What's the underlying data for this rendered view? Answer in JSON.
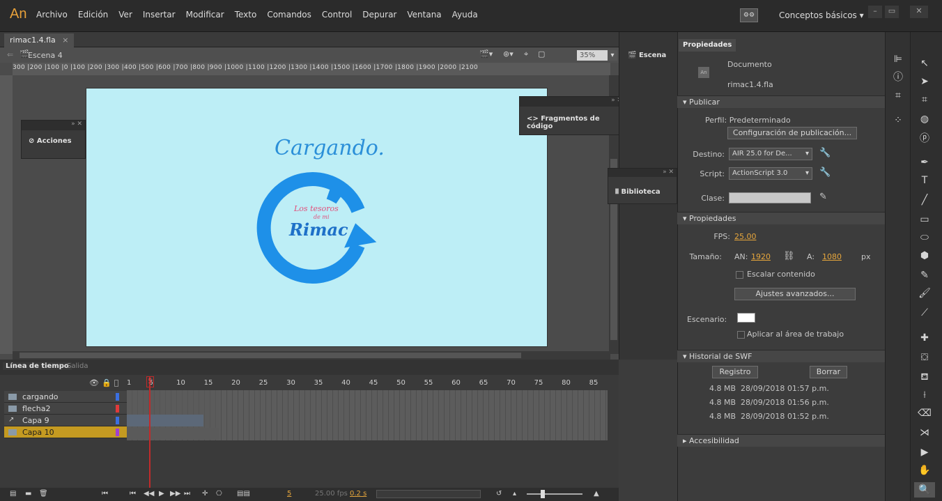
{
  "app": {
    "logo": "An",
    "menu": [
      "Archivo",
      "Edición",
      "Ver",
      "Insertar",
      "Modificar",
      "Texto",
      "Comandos",
      "Control",
      "Depurar",
      "Ventana",
      "Ayuda"
    ],
    "workspace": "Conceptos básicos",
    "win_min": "–",
    "win_max": "▭",
    "win_close": "✕"
  },
  "document": {
    "tab_label": "rimac1.4.fla",
    "tab_close": "×",
    "scene_label": "Escena 4",
    "zoom": "35%",
    "ruler_ticks": "300 |200 |100 |0 |100 |200 |300 |400 |500 |600 |700 |800 |900 |1000 |1100 |1200 |1300 |1400 |1500 |1600 |1700 |1800 |1900 |2000 |2100"
  },
  "stage": {
    "background": "#bdeef6",
    "title_text": "Cargando.",
    "logo_line1": "Los tesoros",
    "logo_line2": "de mi",
    "logo_line3": "Rimac",
    "accent": "#1e90e8"
  },
  "panels": {
    "acciones": "Acciones",
    "fragmentos": "Fragmentos de código",
    "escena": "Escena",
    "biblioteca": "Biblioteca"
  },
  "properties": {
    "tab": "Propiedades",
    "doc_type": "Documento",
    "doc_name": "rimac1.4.fla",
    "publicar": {
      "header": "Publicar",
      "perfil": "Perfil: Predeterminado",
      "config_button": "Configuración de publicación...",
      "destino_label": "Destino:",
      "destino_value": "AIR 25.0 for De...",
      "script_label": "Script:",
      "script_value": "ActionScript 3.0",
      "clase_label": "Clase:"
    },
    "propiedades": {
      "header": "Propiedades",
      "fps_label": "FPS:",
      "fps_value": "25.00",
      "tamano_label": "Tamaño:",
      "an_label": "AN:",
      "an_value": "1920",
      "a_label": "A:",
      "a_value": "1080",
      "unit": "px",
      "escalar": "Escalar contenido",
      "ajustes_button": "Ajustes avanzados...",
      "escenario_label": "Escenario:",
      "aplicar": "Aplicar al área de trabajo"
    },
    "historial": {
      "header": "Historial de SWF",
      "registro_button": "Registro",
      "borrar_button": "Borrar",
      "entries": [
        {
          "size": "4.8 MB",
          "date": "28/09/2018",
          "time": "01:57 p.m."
        },
        {
          "size": "4.8 MB",
          "date": "28/09/2018",
          "time": "01:56 p.m."
        },
        {
          "size": "4.8 MB",
          "date": "28/09/2018",
          "time": "01:52 p.m."
        }
      ]
    },
    "accesibilidad": "Accesibilidad"
  },
  "timeline": {
    "tab_active": "Línea de tiempo",
    "tab_other": "Salida",
    "frame_numbers": [
      "1",
      "5",
      "10",
      "15",
      "20",
      "25",
      "30",
      "35",
      "40",
      "45",
      "50",
      "55",
      "60",
      "65",
      "70",
      "75",
      "80",
      "85"
    ],
    "current_frame": "5",
    "layers": [
      {
        "name": "cargando",
        "color": "#3a6fe0"
      },
      {
        "name": "flecha2",
        "color": "#e03a3a"
      },
      {
        "name": "Capa 9",
        "color": "#3a6fe0"
      },
      {
        "name": "Capa 10",
        "color": "#a040d0"
      }
    ],
    "status_frame": "5",
    "status_fps": "25.00 fps",
    "status_time": "0.2 s"
  }
}
